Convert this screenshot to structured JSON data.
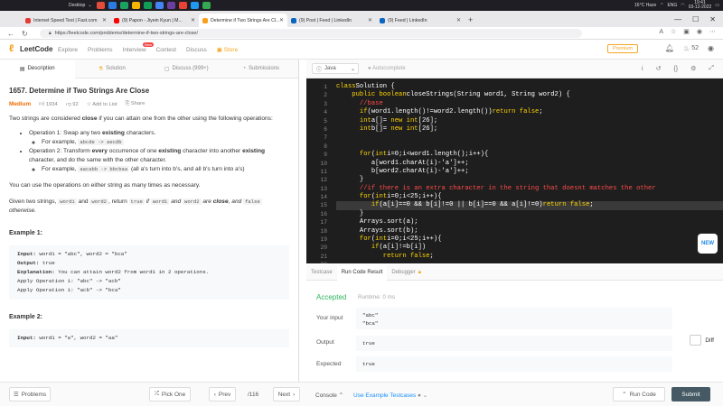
{
  "taskbar": {
    "desktop_label": "Desktop",
    "weather": "16°C Haze",
    "lang": "ENG",
    "time": "19:41",
    "date": "03-12-2022",
    "icon_colors": [
      "#e34b3a",
      "#2b7be4",
      "#1aa260",
      "#f4b400",
      "#0f9d58",
      "#4285f4",
      "#6b3fa0",
      "#ea4335",
      "#2196f3",
      "#34a853"
    ]
  },
  "browser": {
    "tabs": [
      {
        "label": "Internet Speed Test | Fast.com",
        "color": "#e53935"
      },
      {
        "label": "(9) Papon - Jiyein Kyun | M...",
        "color": "#ff0000"
      },
      {
        "label": "Determine if Two Strings Are Cl...",
        "color": "#f89f1b",
        "active": true
      },
      {
        "label": "(9) Post | Feed | LinkedIn",
        "color": "#0a66c2"
      },
      {
        "label": "(9) Feed | LinkedIn",
        "color": "#0a66c2"
      }
    ],
    "url": "https://leetcode.com/problems/determine-if-two-strings-are-close/"
  },
  "lc": {
    "logo": "LeetCode",
    "nav": [
      "Explore",
      "Problems",
      "Interview",
      "Contest",
      "Discuss",
      "Store"
    ],
    "new_badge": "New",
    "premium": "Premium",
    "coins": "52"
  },
  "left_tabs": [
    "Description",
    "Solution",
    "Discuss (999+)",
    "Submissions"
  ],
  "problem": {
    "title": "1657. Determine if Two Strings Are Close",
    "difficulty": "Medium",
    "likes": "1934",
    "dislikes": "92",
    "add_to_list": "Add to List",
    "share": "Share",
    "p1_a": "Two strings are considered ",
    "p1_b": "close",
    "p1_c": " if you can attain one from the other using the following operations:",
    "op1_a": "Operation 1: Swap any two ",
    "op1_b": "existing",
    "op1_c": " characters.",
    "op1_ex_pre": "For example, ",
    "op1_ex_code": "abcde -> aecdb",
    "op2_a": "Operation 2: Transform ",
    "op2_b": "every",
    "op2_c": " occurrence of one ",
    "op2_d": "existing",
    "op2_e": " character into another ",
    "op2_f": "existing",
    "op2_g": " character, and do the same with the other character.",
    "op2_ex_pre": "For example, ",
    "op2_ex_code": "aacabb -> bbcbaa",
    "op2_ex_post": " (all a's turn into b's, and all b's turn into a's)",
    "p2": "You can use the operations on either string as many times as necessary.",
    "p3_a": "Given two strings, ",
    "p3_w1": "word1",
    "p3_and": " and ",
    "p3_w2": "word2",
    "p3_ret": ", return ",
    "p3_true": "true",
    "p3_if": " if ",
    "p3_w1b": "word1",
    "p3_and2": " and ",
    "p3_w2b": "word2",
    "p3_are": " are ",
    "p3_close": "close",
    "p3_and3": ", and ",
    "p3_false": "false",
    "p3_other": " otherwise.",
    "ex1_title": "Example 1:",
    "ex1_lines": [
      {
        "b": "Input:",
        "t": " word1 = \"abc\", word2 = \"bca\""
      },
      {
        "b": "Output:",
        "t": " true"
      },
      {
        "b": "Explanation:",
        "t": " You can attain word2 from word1 in 2 operations."
      },
      {
        "b": "",
        "t": "Apply Operation 1: \"abc\" -> \"acb\""
      },
      {
        "b": "",
        "t": "Apply Operation 1: \"acb\" -> \"bca\""
      }
    ],
    "ex2_title": "Example 2:",
    "ex2_lines": [
      {
        "b": "Input:",
        "t": " word1 = \"a\", word2 = \"aa\""
      }
    ]
  },
  "editor": {
    "language": "Java",
    "autocomplete": "Autocomplete",
    "line_numbers": [
      "1",
      "2",
      "3",
      "4",
      "5",
      "6",
      "7",
      "8",
      "9",
      "10",
      "11",
      "12",
      "13",
      "14",
      "15",
      "16",
      "17",
      "18",
      "19",
      "20",
      "21",
      "22"
    ],
    "lines": [
      [
        [
          "kw",
          "class"
        ],
        [
          "",
          "Solution {"
        ]
      ],
      [
        [
          "",
          "    "
        ],
        [
          "kw",
          "public boolean"
        ],
        [
          "",
          "closeStrings(String word1, String word2) {"
        ]
      ],
      [
        [
          "cm",
          "      //base"
        ]
      ],
      [
        [
          "",
          "      "
        ],
        [
          "kw",
          "if"
        ],
        [
          "",
          "(word1.length()!=word2.length())"
        ],
        [
          "kw",
          "return false"
        ],
        [
          "",
          ";"
        ]
      ],
      [
        [
          "",
          "      "
        ],
        [
          "kw",
          "int"
        ],
        [
          "",
          "a[]= "
        ],
        [
          "kw",
          "new int"
        ],
        [
          "",
          "[26];"
        ]
      ],
      [
        [
          "",
          "      "
        ],
        [
          "kw",
          "int"
        ],
        [
          "",
          "b[]= "
        ],
        [
          "kw",
          "new int"
        ],
        [
          "",
          "[26];"
        ]
      ],
      [
        [
          "",
          ""
        ]
      ],
      [
        [
          "",
          ""
        ]
      ],
      [
        [
          "",
          "      "
        ],
        [
          "kw",
          "for"
        ],
        [
          "",
          "("
        ],
        [
          "kw",
          "int"
        ],
        [
          "",
          "i=0;i<word1.length();i++){"
        ]
      ],
      [
        [
          "",
          "         a[word1.charAt(i)-'a']++;"
        ]
      ],
      [
        [
          "",
          "         b[word2.charAt(i)-'a']++;"
        ]
      ],
      [
        [
          "",
          "      }"
        ]
      ],
      [
        [
          "cm",
          "      //if there is an extra character in the string that doesnt matches the other"
        ]
      ],
      [
        [
          "",
          "      "
        ],
        [
          "kw",
          "for"
        ],
        [
          "",
          "("
        ],
        [
          "kw",
          "int"
        ],
        [
          "",
          "i=0;i<25;i++){"
        ]
      ],
      [
        [
          "",
          "         "
        ],
        [
          "kw",
          "if"
        ],
        [
          "",
          "(a[i]==0 && b[i]!=0 || b[i]==0 && a[i]!=0)"
        ],
        [
          "kw",
          "return false"
        ],
        [
          "",
          ";"
        ]
      ],
      [
        [
          "",
          "      }"
        ]
      ],
      [
        [
          "",
          "      Arrays.sort(a);"
        ]
      ],
      [
        [
          "",
          "      Arrays.sort(b);"
        ]
      ],
      [
        [
          "",
          "      "
        ],
        [
          "kw",
          "for"
        ],
        [
          "",
          "("
        ],
        [
          "kw",
          "int"
        ],
        [
          "",
          "i=0;i<25;i++){"
        ]
      ],
      [
        [
          "",
          "         "
        ],
        [
          "kw",
          "if"
        ],
        [
          "",
          "(a[i]!=b[i])"
        ]
      ],
      [
        [
          "",
          "            "
        ],
        [
          "kw",
          "return false"
        ],
        [
          "",
          ";"
        ]
      ],
      [
        [
          "",
          ""
        ]
      ]
    ],
    "highlight_line": 15,
    "new_label": "NEW"
  },
  "console": {
    "tabs": [
      "Testcase",
      "Run Code Result",
      "Debugger"
    ],
    "status": "Accepted",
    "runtime": "Runtime: 0 ms",
    "your_input_label": "Your input",
    "your_input": [
      "\"abc\"",
      "\"bca\""
    ],
    "output_label": "Output",
    "output": "true",
    "expected_label": "Expected",
    "expected": "true",
    "diff_label": "Diff"
  },
  "bottom": {
    "problems": "Problems",
    "pick_one": "Pick One",
    "prev": "Prev",
    "page": "/116",
    "next": "Next",
    "console": "Console",
    "use_example": "Use Example Testcases",
    "run_code": "Run Code",
    "submit": "Submit"
  }
}
